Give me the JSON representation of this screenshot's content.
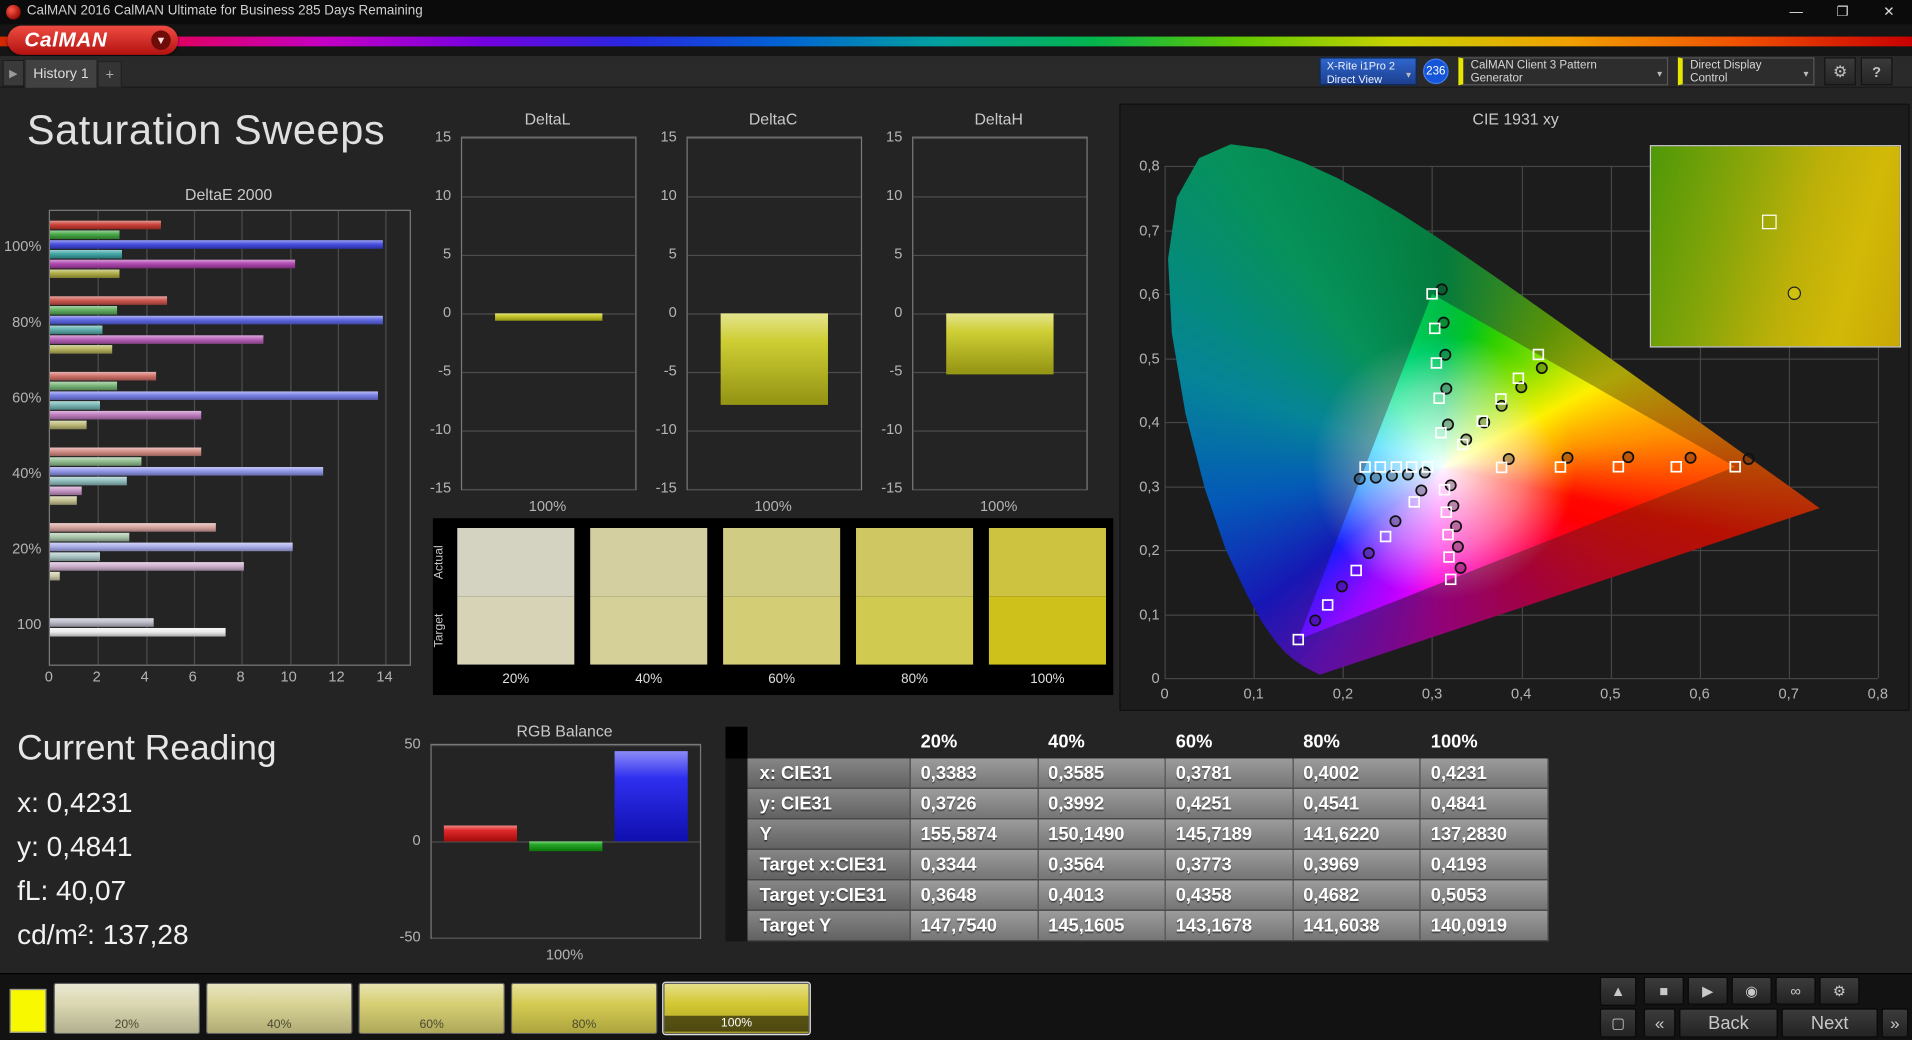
{
  "window": {
    "title": "CalMAN 2016 CalMAN Ultimate for Business 285 Days Remaining",
    "minimize": "—",
    "maximize": "❐",
    "close": "✕"
  },
  "brand": {
    "logo": "CalMAN",
    "caret": "▼"
  },
  "tab_bar": {
    "collapse": "▶",
    "history_tab": "History 1",
    "add_tab": "+"
  },
  "device_bar": {
    "meter_line1": "X-Rite i1Pro 2",
    "meter_line2": "Direct View",
    "meter_badge": "236",
    "pattern_generator": "CalMAN Client 3 Pattern Generator",
    "display_control": "Direct Display Control",
    "caret": "▾",
    "settings_icon": "⚙",
    "help_icon": "?"
  },
  "page": {
    "title": "Saturation Sweeps"
  },
  "current_reading": {
    "title": "Current Reading",
    "lines": [
      "x: 0,4231",
      "y: 0,4841",
      "fL: 40,07",
      "cd/m²: 137,28"
    ]
  },
  "comparison_strip": {
    "row_labels": [
      "Actual",
      "Target"
    ],
    "columns": [
      {
        "label": "20%",
        "actual": "#d4d2c0",
        "target": "#d6d3b6"
      },
      {
        "label": "40%",
        "actual": "#d3cfa1",
        "target": "#d5d097"
      },
      {
        "label": "60%",
        "actual": "#d1cc83",
        "target": "#d3ce76"
      },
      {
        "label": "80%",
        "actual": "#cfc862",
        "target": "#d1ca50"
      },
      {
        "label": "100%",
        "actual": "#cdc340",
        "target": "#cfc11c"
      }
    ]
  },
  "table": {
    "columns": [
      "20%",
      "40%",
      "60%",
      "80%",
      "100%"
    ],
    "rows": [
      {
        "label": "x: CIE31",
        "values": [
          "0,3383",
          "0,3585",
          "0,3781",
          "0,4002",
          "0,4231"
        ]
      },
      {
        "label": "y: CIE31",
        "values": [
          "0,3726",
          "0,3992",
          "0,4251",
          "0,4541",
          "0,4841"
        ]
      },
      {
        "label": "Y",
        "values": [
          "155,5874",
          "150,1490",
          "145,7189",
          "141,6220",
          "137,2830"
        ]
      },
      {
        "label": "Target x:CIE31",
        "values": [
          "0,3344",
          "0,3564",
          "0,3773",
          "0,3969",
          "0,4193"
        ]
      },
      {
        "label": "Target y:CIE31",
        "values": [
          "0,3648",
          "0,4013",
          "0,4358",
          "0,4682",
          "0,5053"
        ]
      },
      {
        "label": "Target Y",
        "values": [
          "147,7540",
          "145,1605",
          "143,1678",
          "141,6038",
          "140,0919"
        ]
      }
    ]
  },
  "bottom_bar": {
    "current_patch_color": "#f8f800",
    "swatches": [
      {
        "label": "20%",
        "color": "#d9d6ae",
        "selected": false
      },
      {
        "label": "40%",
        "color": "#d7d18f",
        "selected": false
      },
      {
        "label": "60%",
        "color": "#d5cd6d",
        "selected": false
      },
      {
        "label": "80%",
        "color": "#d3c94b",
        "selected": false
      },
      {
        "label": "100%",
        "color": "#d1c529",
        "selected": true
      }
    ],
    "back": "Back",
    "next": "Next",
    "icons": {
      "up": "▲",
      "window": "▢",
      "stop": "■",
      "play": "▶",
      "snapshot": "◉",
      "continuous": "∞",
      "settings": "⚙",
      "prev": "«",
      "next": "»"
    }
  },
  "chart_data": [
    {
      "id": "deltae2000",
      "type": "bar",
      "orientation": "horizontal",
      "title": "DeltaE 2000",
      "xlim": [
        0,
        15
      ],
      "xticks": [
        0,
        2,
        4,
        6,
        8,
        10,
        12,
        14
      ],
      "groups": [
        {
          "label": "100%",
          "bars": [
            {
              "name": "red",
              "color": "#c8342a",
              "value": 4.6
            },
            {
              "name": "green",
              "color": "#3aa23a",
              "value": 2.9
            },
            {
              "name": "blue",
              "color": "#3a42e0",
              "value": 13.9
            },
            {
              "name": "cyan",
              "color": "#35a0a0",
              "value": 3.0
            },
            {
              "name": "magenta",
              "color": "#ab3cab",
              "value": 10.2
            },
            {
              "name": "yellow",
              "color": "#aaa73a",
              "value": 2.9
            }
          ]
        },
        {
          "label": "80%",
          "bars": [
            {
              "name": "red",
              "color": "#cb4f46",
              "value": 4.9
            },
            {
              "name": "green",
              "color": "#55aa55",
              "value": 2.8
            },
            {
              "name": "blue",
              "color": "#5560e2",
              "value": 13.9
            },
            {
              "name": "cyan",
              "color": "#55aaaa",
              "value": 2.2
            },
            {
              "name": "magenta",
              "color": "#b358b3",
              "value": 8.9
            },
            {
              "name": "yellow",
              "color": "#b2af55",
              "value": 2.6
            }
          ]
        },
        {
          "label": "60%",
          "bars": [
            {
              "name": "red",
              "color": "#cf6a62",
              "value": 4.4
            },
            {
              "name": "green",
              "color": "#70b270",
              "value": 2.8
            },
            {
              "name": "blue",
              "color": "#7078e5",
              "value": 13.7
            },
            {
              "name": "cyan",
              "color": "#70b2b2",
              "value": 2.1
            },
            {
              "name": "magenta",
              "color": "#bb74bb",
              "value": 6.3
            },
            {
              "name": "yellow",
              "color": "#bab770",
              "value": 1.5
            }
          ]
        },
        {
          "label": "40%",
          "bars": [
            {
              "name": "red",
              "color": "#d2867f",
              "value": 6.3
            },
            {
              "name": "green",
              "color": "#8bbb8b",
              "value": 3.8
            },
            {
              "name": "blue",
              "color": "#8b91e8",
              "value": 11.4
            },
            {
              "name": "cyan",
              "color": "#8bbbbb",
              "value": 3.2
            },
            {
              "name": "magenta",
              "color": "#c490c4",
              "value": 1.3
            },
            {
              "name": "yellow",
              "color": "#c2bf8b",
              "value": 1.1
            }
          ]
        },
        {
          "label": "20%",
          "bars": [
            {
              "name": "red",
              "color": "#d6a19b",
              "value": 6.9
            },
            {
              "name": "green",
              "color": "#a6c3a6",
              "value": 3.3
            },
            {
              "name": "blue",
              "color": "#a6a9ea",
              "value": 10.1
            },
            {
              "name": "cyan",
              "color": "#a6c3c3",
              "value": 2.1
            },
            {
              "name": "magenta",
              "color": "#ccaccc",
              "value": 8.1
            },
            {
              "name": "yellow",
              "color": "#cac7a6",
              "value": 0.4
            }
          ]
        },
        {
          "label": "100",
          "bars": [
            {
              "name": "gray",
              "color": "#b9b9c8",
              "value": 4.3
            },
            {
              "name": "white",
              "color": "#ebebeb",
              "value": 7.3
            }
          ]
        }
      ]
    },
    {
      "id": "delta_l",
      "type": "bar",
      "title": "DeltaL",
      "ylim": [
        -15,
        15
      ],
      "yticks": [
        15,
        10,
        5,
        0,
        -5,
        -10,
        -15
      ],
      "xlabel": "100%",
      "value": -0.6,
      "color": "#c9c91d"
    },
    {
      "id": "delta_c",
      "type": "bar",
      "title": "DeltaC",
      "ylim": [
        -15,
        15
      ],
      "yticks": [
        15,
        10,
        5,
        0,
        -5,
        -10,
        -15
      ],
      "xlabel": "100%",
      "value": -7.8,
      "color": "#c9c91d"
    },
    {
      "id": "delta_h",
      "type": "bar",
      "title": "DeltaH",
      "ylim": [
        -15,
        15
      ],
      "yticks": [
        15,
        10,
        5,
        0,
        -5,
        -10,
        -15
      ],
      "xlabel": "100%",
      "value": -5.2,
      "color": "#c9c91d"
    },
    {
      "id": "rgb_balance",
      "type": "bar",
      "title": "RGB Balance",
      "ylim": [
        -50,
        50
      ],
      "yticks": [
        50,
        0,
        -50
      ],
      "xlabel": "100%",
      "series": [
        {
          "name": "red",
          "color": "#dd1111",
          "value": 8
        },
        {
          "name": "green",
          "color": "#0fa00f",
          "value": -5
        },
        {
          "name": "blue",
          "color": "#1717ee",
          "value": 47
        }
      ]
    },
    {
      "id": "cie1931",
      "type": "scatter",
      "title": "CIE 1931 xy",
      "xlim": [
        0,
        0.8
      ],
      "ylim": [
        0,
        0.8
      ],
      "xtick_labels": [
        "0",
        "0,1",
        "0,2",
        "0,3",
        "0,4",
        "0,5",
        "0,6",
        "0,7",
        "0,8"
      ],
      "ytick_labels": [
        "0",
        "0,1",
        "0,2",
        "0,3",
        "0,4",
        "0,5",
        "0,6",
        "0,7",
        "0,8"
      ],
      "white_point": [
        0.3127,
        0.329
      ],
      "gamut_triangle": [
        [
          0.64,
          0.33
        ],
        [
          0.3,
          0.6
        ],
        [
          0.15,
          0.06
        ]
      ],
      "sweeps": [
        {
          "name": "red",
          "target": [
            [
              0.378,
              0.329
            ],
            [
              0.444,
              0.3295
            ],
            [
              0.509,
              0.33
            ],
            [
              0.574,
              0.33
            ],
            [
              0.64,
              0.33
            ]
          ],
          "measured": [
            [
              0.386,
              0.342
            ],
            [
              0.452,
              0.344
            ],
            [
              0.52,
              0.345
            ],
            [
              0.59,
              0.344
            ],
            [
              0.655,
              0.342
            ]
          ]
        },
        {
          "name": "green",
          "target": [
            [
              0.31,
              0.383
            ],
            [
              0.308,
              0.437
            ],
            [
              0.305,
              0.492
            ],
            [
              0.303,
              0.546
            ],
            [
              0.3,
              0.6
            ]
          ],
          "measured": [
            [
              0.318,
              0.396
            ],
            [
              0.316,
              0.452
            ],
            [
              0.315,
              0.505
            ],
            [
              0.313,
              0.555
            ],
            [
              0.311,
              0.607
            ]
          ]
        },
        {
          "name": "blue",
          "target": [
            [
              0.28,
              0.275
            ],
            [
              0.248,
              0.221
            ],
            [
              0.215,
              0.168
            ],
            [
              0.183,
              0.114
            ],
            [
              0.15,
              0.06
            ]
          ],
          "measured": [
            [
              0.288,
              0.293
            ],
            [
              0.259,
              0.245
            ],
            [
              0.229,
              0.195
            ],
            [
              0.199,
              0.143
            ],
            [
              0.169,
              0.09
            ]
          ]
        },
        {
          "name": "cyan",
          "target": [
            [
              0.295,
              0.3295
            ],
            [
              0.277,
              0.3295
            ],
            [
              0.26,
              0.3295
            ],
            [
              0.242,
              0.3295
            ],
            [
              0.225,
              0.3295
            ]
          ],
          "measured": [
            [
              0.292,
              0.321
            ],
            [
              0.273,
              0.318
            ],
            [
              0.255,
              0.316
            ],
            [
              0.237,
              0.313
            ],
            [
              0.219,
              0.311
            ]
          ]
        },
        {
          "name": "magenta",
          "target": [
            [
              0.314,
              0.294
            ],
            [
              0.316,
              0.259
            ],
            [
              0.318,
              0.224
            ],
            [
              0.319,
              0.189
            ],
            [
              0.321,
              0.154
            ]
          ],
          "measured": [
            [
              0.321,
              0.301
            ],
            [
              0.324,
              0.269
            ],
            [
              0.327,
              0.237
            ],
            [
              0.329,
              0.205
            ],
            [
              0.332,
              0.172
            ]
          ]
        },
        {
          "name": "yellow",
          "target": [
            [
              0.3344,
              0.3648
            ],
            [
              0.3564,
              0.4013
            ],
            [
              0.3773,
              0.4358
            ],
            [
              0.3969,
              0.4682
            ],
            [
              0.4193,
              0.5053
            ]
          ],
          "measured": [
            [
              0.3383,
              0.3726
            ],
            [
              0.3585,
              0.3992
            ],
            [
              0.3781,
              0.4251
            ],
            [
              0.4002,
              0.4541
            ],
            [
              0.4231,
              0.4841
            ]
          ]
        }
      ],
      "inset": {
        "square": [
          47,
          37
        ],
        "circle": [
          57,
          73
        ]
      }
    }
  ]
}
